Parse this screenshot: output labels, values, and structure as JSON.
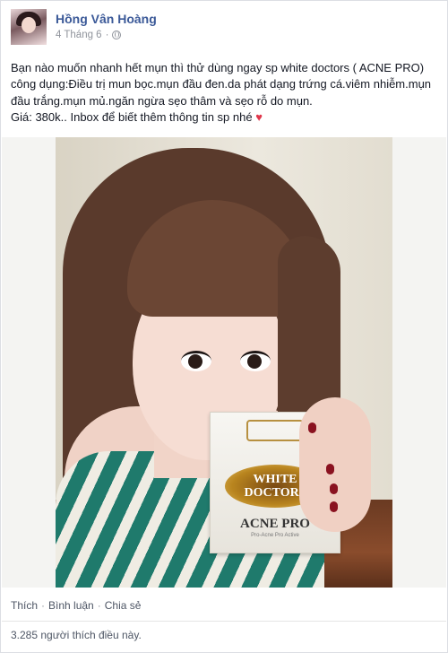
{
  "post": {
    "author": "Hồng Vân Hoàng",
    "date": "4 Tháng 6",
    "privacy_icon": "globe-icon",
    "text_lines": [
      "Bạn nào muốn nhanh hết mụn thì thử dùng ngay sp white doctors ( ACNE PRO)",
      "công dụng:Điều trị mun bọc.mụn đầu đen.da phát dạng trứng cá.viêm nhiễm.mụn",
      "đầu trắng.mụn mủ.ngăn ngừa sẹo thâm và sẹo rỗ do mụn.",
      "Giá: 380k.. Inbox để biết thêm thông tin sp nhé"
    ],
    "heart_glyph": "♥"
  },
  "product": {
    "brand_line1": "WHITE",
    "brand_line2": "DOCTORS",
    "name": "ACNE PRO",
    "tagline": "Pro-Acne Pro Active"
  },
  "actions": {
    "like": "Thích",
    "comment": "Bình luận",
    "share": "Chia sẻ",
    "separator": "·"
  },
  "likes_summary": "3.285 người thích điều này."
}
